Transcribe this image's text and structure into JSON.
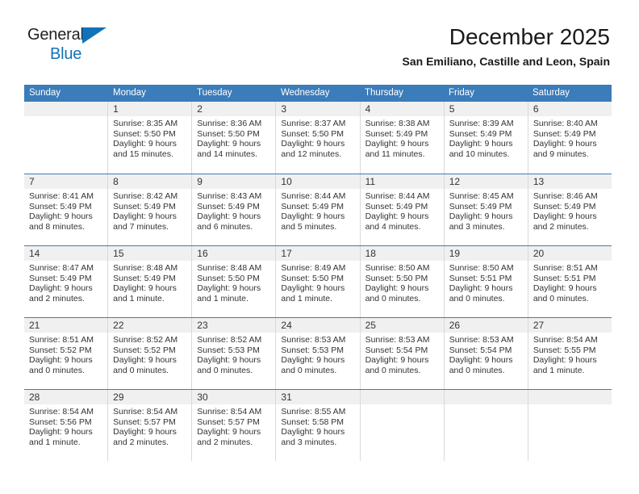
{
  "brand": {
    "name_part1": "General",
    "name_part2": "Blue"
  },
  "header": {
    "title": "December 2025",
    "subtitle": "San Emiliano, Castille and Leon, Spain"
  },
  "colors": {
    "header_blue": "#3b7cba",
    "brand_blue": "#1272b8",
    "daynum_band": "#f0f0f0",
    "cell_divider": "#d9d9d9"
  },
  "weekdays": [
    "Sunday",
    "Monday",
    "Tuesday",
    "Wednesday",
    "Thursday",
    "Friday",
    "Saturday"
  ],
  "labels": {
    "sunrise_prefix": "Sunrise:",
    "sunset_prefix": "Sunset:",
    "daylight_prefix": "Daylight:"
  },
  "weeks": [
    [
      {
        "day": "",
        "sunrise": "",
        "sunset": "",
        "daylight_1": "",
        "daylight_2": ""
      },
      {
        "day": "1",
        "sunrise": "Sunrise: 8:35 AM",
        "sunset": "Sunset: 5:50 PM",
        "daylight_1": "Daylight: 9 hours",
        "daylight_2": "and 15 minutes."
      },
      {
        "day": "2",
        "sunrise": "Sunrise: 8:36 AM",
        "sunset": "Sunset: 5:50 PM",
        "daylight_1": "Daylight: 9 hours",
        "daylight_2": "and 14 minutes."
      },
      {
        "day": "3",
        "sunrise": "Sunrise: 8:37 AM",
        "sunset": "Sunset: 5:50 PM",
        "daylight_1": "Daylight: 9 hours",
        "daylight_2": "and 12 minutes."
      },
      {
        "day": "4",
        "sunrise": "Sunrise: 8:38 AM",
        "sunset": "Sunset: 5:49 PM",
        "daylight_1": "Daylight: 9 hours",
        "daylight_2": "and 11 minutes."
      },
      {
        "day": "5",
        "sunrise": "Sunrise: 8:39 AM",
        "sunset": "Sunset: 5:49 PM",
        "daylight_1": "Daylight: 9 hours",
        "daylight_2": "and 10 minutes."
      },
      {
        "day": "6",
        "sunrise": "Sunrise: 8:40 AM",
        "sunset": "Sunset: 5:49 PM",
        "daylight_1": "Daylight: 9 hours",
        "daylight_2": "and 9 minutes."
      }
    ],
    [
      {
        "day": "7",
        "sunrise": "Sunrise: 8:41 AM",
        "sunset": "Sunset: 5:49 PM",
        "daylight_1": "Daylight: 9 hours",
        "daylight_2": "and 8 minutes."
      },
      {
        "day": "8",
        "sunrise": "Sunrise: 8:42 AM",
        "sunset": "Sunset: 5:49 PM",
        "daylight_1": "Daylight: 9 hours",
        "daylight_2": "and 7 minutes."
      },
      {
        "day": "9",
        "sunrise": "Sunrise: 8:43 AM",
        "sunset": "Sunset: 5:49 PM",
        "daylight_1": "Daylight: 9 hours",
        "daylight_2": "and 6 minutes."
      },
      {
        "day": "10",
        "sunrise": "Sunrise: 8:44 AM",
        "sunset": "Sunset: 5:49 PM",
        "daylight_1": "Daylight: 9 hours",
        "daylight_2": "and 5 minutes."
      },
      {
        "day": "11",
        "sunrise": "Sunrise: 8:44 AM",
        "sunset": "Sunset: 5:49 PM",
        "daylight_1": "Daylight: 9 hours",
        "daylight_2": "and 4 minutes."
      },
      {
        "day": "12",
        "sunrise": "Sunrise: 8:45 AM",
        "sunset": "Sunset: 5:49 PM",
        "daylight_1": "Daylight: 9 hours",
        "daylight_2": "and 3 minutes."
      },
      {
        "day": "13",
        "sunrise": "Sunrise: 8:46 AM",
        "sunset": "Sunset: 5:49 PM",
        "daylight_1": "Daylight: 9 hours",
        "daylight_2": "and 2 minutes."
      }
    ],
    [
      {
        "day": "14",
        "sunrise": "Sunrise: 8:47 AM",
        "sunset": "Sunset: 5:49 PM",
        "daylight_1": "Daylight: 9 hours",
        "daylight_2": "and 2 minutes."
      },
      {
        "day": "15",
        "sunrise": "Sunrise: 8:48 AM",
        "sunset": "Sunset: 5:49 PM",
        "daylight_1": "Daylight: 9 hours",
        "daylight_2": "and 1 minute."
      },
      {
        "day": "16",
        "sunrise": "Sunrise: 8:48 AM",
        "sunset": "Sunset: 5:50 PM",
        "daylight_1": "Daylight: 9 hours",
        "daylight_2": "and 1 minute."
      },
      {
        "day": "17",
        "sunrise": "Sunrise: 8:49 AM",
        "sunset": "Sunset: 5:50 PM",
        "daylight_1": "Daylight: 9 hours",
        "daylight_2": "and 1 minute."
      },
      {
        "day": "18",
        "sunrise": "Sunrise: 8:50 AM",
        "sunset": "Sunset: 5:50 PM",
        "daylight_1": "Daylight: 9 hours",
        "daylight_2": "and 0 minutes."
      },
      {
        "day": "19",
        "sunrise": "Sunrise: 8:50 AM",
        "sunset": "Sunset: 5:51 PM",
        "daylight_1": "Daylight: 9 hours",
        "daylight_2": "and 0 minutes."
      },
      {
        "day": "20",
        "sunrise": "Sunrise: 8:51 AM",
        "sunset": "Sunset: 5:51 PM",
        "daylight_1": "Daylight: 9 hours",
        "daylight_2": "and 0 minutes."
      }
    ],
    [
      {
        "day": "21",
        "sunrise": "Sunrise: 8:51 AM",
        "sunset": "Sunset: 5:52 PM",
        "daylight_1": "Daylight: 9 hours",
        "daylight_2": "and 0 minutes."
      },
      {
        "day": "22",
        "sunrise": "Sunrise: 8:52 AM",
        "sunset": "Sunset: 5:52 PM",
        "daylight_1": "Daylight: 9 hours",
        "daylight_2": "and 0 minutes."
      },
      {
        "day": "23",
        "sunrise": "Sunrise: 8:52 AM",
        "sunset": "Sunset: 5:53 PM",
        "daylight_1": "Daylight: 9 hours",
        "daylight_2": "and 0 minutes."
      },
      {
        "day": "24",
        "sunrise": "Sunrise: 8:53 AM",
        "sunset": "Sunset: 5:53 PM",
        "daylight_1": "Daylight: 9 hours",
        "daylight_2": "and 0 minutes."
      },
      {
        "day": "25",
        "sunrise": "Sunrise: 8:53 AM",
        "sunset": "Sunset: 5:54 PM",
        "daylight_1": "Daylight: 9 hours",
        "daylight_2": "and 0 minutes."
      },
      {
        "day": "26",
        "sunrise": "Sunrise: 8:53 AM",
        "sunset": "Sunset: 5:54 PM",
        "daylight_1": "Daylight: 9 hours",
        "daylight_2": "and 0 minutes."
      },
      {
        "day": "27",
        "sunrise": "Sunrise: 8:54 AM",
        "sunset": "Sunset: 5:55 PM",
        "daylight_1": "Daylight: 9 hours",
        "daylight_2": "and 1 minute."
      }
    ],
    [
      {
        "day": "28",
        "sunrise": "Sunrise: 8:54 AM",
        "sunset": "Sunset: 5:56 PM",
        "daylight_1": "Daylight: 9 hours",
        "daylight_2": "and 1 minute."
      },
      {
        "day": "29",
        "sunrise": "Sunrise: 8:54 AM",
        "sunset": "Sunset: 5:57 PM",
        "daylight_1": "Daylight: 9 hours",
        "daylight_2": "and 2 minutes."
      },
      {
        "day": "30",
        "sunrise": "Sunrise: 8:54 AM",
        "sunset": "Sunset: 5:57 PM",
        "daylight_1": "Daylight: 9 hours",
        "daylight_2": "and 2 minutes."
      },
      {
        "day": "31",
        "sunrise": "Sunrise: 8:55 AM",
        "sunset": "Sunset: 5:58 PM",
        "daylight_1": "Daylight: 9 hours",
        "daylight_2": "and 3 minutes."
      },
      {
        "day": "",
        "sunrise": "",
        "sunset": "",
        "daylight_1": "",
        "daylight_2": ""
      },
      {
        "day": "",
        "sunrise": "",
        "sunset": "",
        "daylight_1": "",
        "daylight_2": ""
      },
      {
        "day": "",
        "sunrise": "",
        "sunset": "",
        "daylight_1": "",
        "daylight_2": ""
      }
    ]
  ]
}
